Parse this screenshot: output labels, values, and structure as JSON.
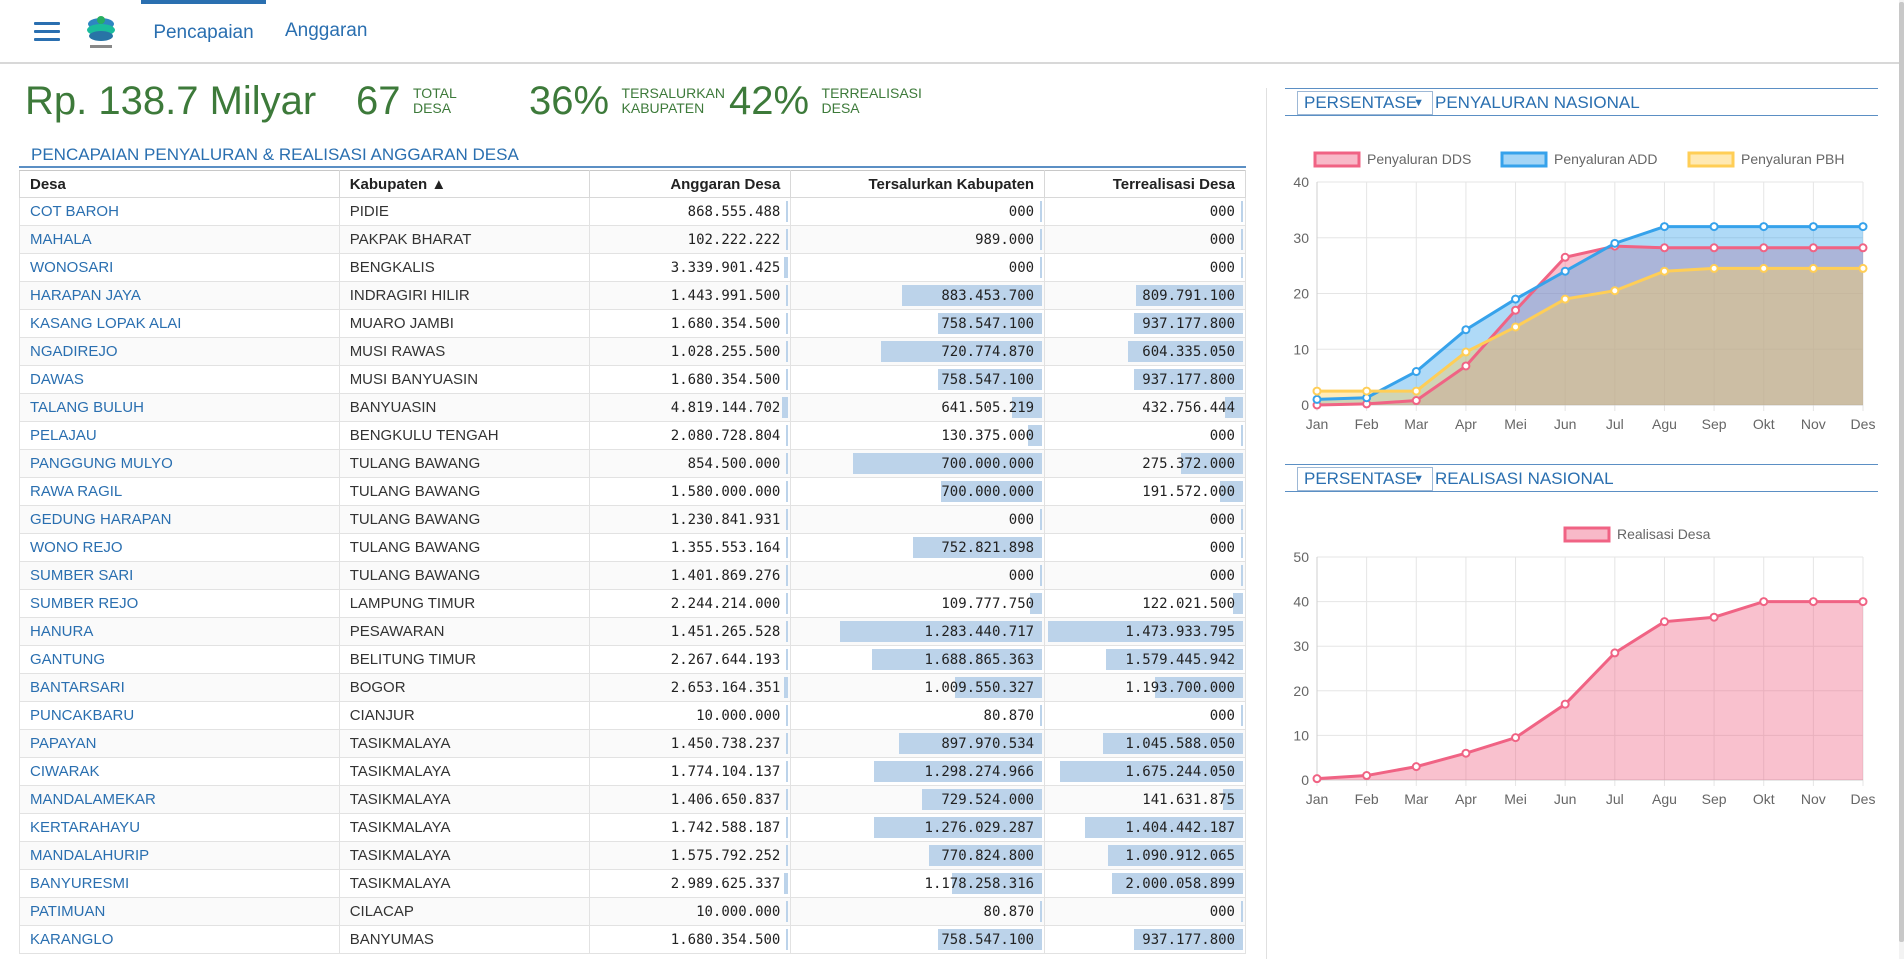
{
  "nav": {
    "menu_icon": "hamburger-menu-icon",
    "logo_icon": "kementerian-logo-icon",
    "tabs": [
      {
        "label": "Pencapaian",
        "active": true
      },
      {
        "label": "Anggaran",
        "active": false
      }
    ]
  },
  "summary": {
    "total_amount": "Rp. 138.7 Milyar",
    "total_desa_value": "67",
    "total_desa_label_1": "TOTAL",
    "total_desa_label_2": "DESA",
    "tersalurkan_value": "36%",
    "tersalurkan_label_1": "TERSALURKAN",
    "tersalurkan_label_2": "KABUPATEN",
    "terrealisasi_value": "42%",
    "terrealisasi_label_1": "TERREALISASI",
    "terrealisasi_label_2": "DESA"
  },
  "table": {
    "title": "PENCAPAIAN PENYALURAN & REALISASI ANGGARAN DESA",
    "columns": [
      "Desa",
      "Kabupaten ▲",
      "Anggaran Desa",
      "Tersalurkan Kabupaten",
      "Terrealisasi Desa"
    ],
    "rows": [
      {
        "desa": "COT BAROH",
        "kab": "PIDIE",
        "ang": "868.555.488",
        "ters": "000",
        "terr": "000",
        "ang_r": 0.01,
        "ters_r": 0.01,
        "terr_r": 0.01
      },
      {
        "desa": "MAHALA",
        "kab": "PAKPAK BHARAT",
        "ang": "102.222.222",
        "ters": "989.000",
        "terr": "000",
        "ang_r": 0.01,
        "ters_r": 0.01,
        "terr_r": 0.01
      },
      {
        "desa": "WONOSARI",
        "kab": "BENGKALIS",
        "ang": "3.339.901.425",
        "ters": "000",
        "terr": "000",
        "ang_r": 0.02,
        "ters_r": 0.01,
        "terr_r": 0.01
      },
      {
        "desa": "HARAPAN JAYA",
        "kab": "INDRAGIRI HILIR",
        "ang": "1.443.991.500",
        "ters": "883.453.700",
        "terr": "809.791.100",
        "ang_r": 0.01,
        "ters_r": 0.61,
        "terr_r": 0.55
      },
      {
        "desa": "KASANG LOPAK ALAI",
        "kab": "MUARO JAMBI",
        "ang": "1.680.354.500",
        "ters": "758.547.100",
        "terr": "937.177.800",
        "ang_r": 0.01,
        "ters_r": 0.45,
        "terr_r": 0.56
      },
      {
        "desa": "NGADIREJO",
        "kab": "MUSI RAWAS",
        "ang": "1.028.255.500",
        "ters": "720.774.870",
        "terr": "604.335.050",
        "ang_r": 0.01,
        "ters_r": 0.7,
        "terr_r": 0.59
      },
      {
        "desa": "DAWAS",
        "kab": "MUSI BANYUASIN",
        "ang": "1.680.354.500",
        "ters": "758.547.100",
        "terr": "937.177.800",
        "ang_r": 0.01,
        "ters_r": 0.45,
        "terr_r": 0.56
      },
      {
        "desa": "TALANG BULUH",
        "kab": "BANYUASIN",
        "ang": "4.819.144.702",
        "ters": "641.505.219",
        "terr": "432.756.444",
        "ang_r": 0.03,
        "ters_r": 0.13,
        "terr_r": 0.09
      },
      {
        "desa": "PELAJAU",
        "kab": "BENGKULU TENGAH",
        "ang": "2.080.728.804",
        "ters": "130.375.000",
        "terr": "000",
        "ang_r": 0.01,
        "ters_r": 0.06,
        "terr_r": 0.01
      },
      {
        "desa": "PANGGUNG MULYO",
        "kab": "TULANG BAWANG",
        "ang": "854.500.000",
        "ters": "700.000.000",
        "terr": "275.372.000",
        "ang_r": 0.01,
        "ters_r": 0.82,
        "terr_r": 0.32
      },
      {
        "desa": "RAWA RAGIL",
        "kab": "TULANG BAWANG",
        "ang": "1.580.000.000",
        "ters": "700.000.000",
        "terr": "191.572.000",
        "ang_r": 0.01,
        "ters_r": 0.44,
        "terr_r": 0.12
      },
      {
        "desa": "GEDUNG HARAPAN",
        "kab": "TULANG BAWANG",
        "ang": "1.230.841.931",
        "ters": "000",
        "terr": "000",
        "ang_r": 0.01,
        "ters_r": 0.01,
        "terr_r": 0.01
      },
      {
        "desa": "WONO REJO",
        "kab": "TULANG BAWANG",
        "ang": "1.355.553.164",
        "ters": "752.821.898",
        "terr": "000",
        "ang_r": 0.01,
        "ters_r": 0.56,
        "terr_r": 0.01
      },
      {
        "desa": "SUMBER SARI",
        "kab": "TULANG BAWANG",
        "ang": "1.401.869.276",
        "ters": "000",
        "terr": "000",
        "ang_r": 0.01,
        "ters_r": 0.01,
        "terr_r": 0.01
      },
      {
        "desa": "SUMBER REJO",
        "kab": "LAMPUNG TIMUR",
        "ang": "2.244.214.000",
        "ters": "109.777.750",
        "terr": "122.021.500",
        "ang_r": 0.01,
        "ters_r": 0.05,
        "terr_r": 0.05
      },
      {
        "desa": "HANURA",
        "kab": "PESAWARAN",
        "ang": "1.451.265.528",
        "ters": "1.283.440.717",
        "terr": "1.473.933.795",
        "ang_r": 0.01,
        "ters_r": 0.88,
        "terr_r": 1.0
      },
      {
        "desa": "GANTUNG",
        "kab": "BELITUNG TIMUR",
        "ang": "2.267.644.193",
        "ters": "1.688.865.363",
        "terr": "1.579.445.942",
        "ang_r": 0.01,
        "ters_r": 0.74,
        "terr_r": 0.7
      },
      {
        "desa": "BANTARSARI",
        "kab": "BOGOR",
        "ang": "2.653.164.351",
        "ters": "1.009.550.327",
        "terr": "1.193.700.000",
        "ang_r": 0.02,
        "ters_r": 0.38,
        "terr_r": 0.45
      },
      {
        "desa": "PUNCAKBARU",
        "kab": "CIANJUR",
        "ang": "10.000.000",
        "ters": "80.870",
        "terr": "000",
        "ang_r": 0.01,
        "ters_r": 0.01,
        "terr_r": 0.01
      },
      {
        "desa": "PAPAYAN",
        "kab": "TASIKMALAYA",
        "ang": "1.450.738.237",
        "ters": "897.970.534",
        "terr": "1.045.588.050",
        "ang_r": 0.01,
        "ters_r": 0.62,
        "terr_r": 0.72
      },
      {
        "desa": "CIWARAK",
        "kab": "TASIKMALAYA",
        "ang": "1.774.104.137",
        "ters": "1.298.274.966",
        "terr": "1.675.244.050",
        "ang_r": 0.01,
        "ters_r": 0.73,
        "terr_r": 0.94
      },
      {
        "desa": "MANDALAMEKAR",
        "kab": "TASIKMALAYA",
        "ang": "1.406.650.837",
        "ters": "729.524.000",
        "terr": "141.631.875",
        "ang_r": 0.01,
        "ters_r": 0.52,
        "terr_r": 0.1
      },
      {
        "desa": "KERTARAHAYU",
        "kab": "TASIKMALAYA",
        "ang": "1.742.588.187",
        "ters": "1.276.029.287",
        "terr": "1.404.442.187",
        "ang_r": 0.01,
        "ters_r": 0.73,
        "terr_r": 0.81
      },
      {
        "desa": "MANDALAHURIP",
        "kab": "TASIKMALAYA",
        "ang": "1.575.792.252",
        "ters": "770.824.800",
        "terr": "1.090.912.065",
        "ang_r": 0.01,
        "ters_r": 0.49,
        "terr_r": 0.69
      },
      {
        "desa": "BANYURESMI",
        "kab": "TASIKMALAYA",
        "ang": "2.989.625.337",
        "ters": "1.178.258.316",
        "terr": "2.000.058.899",
        "ang_r": 0.02,
        "ters_r": 0.39,
        "terr_r": 0.67
      },
      {
        "desa": "PATIMUAN",
        "kab": "CILACAP",
        "ang": "10.000.000",
        "ters": "80.870",
        "terr": "000",
        "ang_r": 0.01,
        "ters_r": 0.01,
        "terr_r": 0.01
      },
      {
        "desa": "KARANGLO",
        "kab": "BANYUMAS",
        "ang": "1.680.354.500",
        "ters": "758.547.100",
        "terr": "937.177.800",
        "ang_r": 0.01,
        "ters_r": 0.45,
        "terr_r": 0.56
      }
    ]
  },
  "panel1": {
    "select_label": "PERSENTASE",
    "title": "PENYALURAN NASIONAL"
  },
  "panel2": {
    "select_label": "PERSENTASE",
    "title": "REALISASI NASIONAL"
  },
  "chart_data": [
    {
      "type": "area",
      "categories": [
        "Jan",
        "Feb",
        "Mar",
        "Apr",
        "Mei",
        "Jun",
        "Jul",
        "Agu",
        "Sep",
        "Okt",
        "Nov",
        "Des"
      ],
      "series": [
        {
          "name": "Penyaluran DDS",
          "color": "#f06384",
          "values": [
            0,
            0.2,
            0.8,
            7,
            17,
            26.5,
            28.5,
            28.2,
            28.2,
            28.2,
            28.2,
            28.2
          ]
        },
        {
          "name": "Penyaluran ADD",
          "color": "#36a2eb",
          "values": [
            1,
            1.3,
            6,
            13.5,
            19,
            24,
            29,
            32,
            32,
            32,
            32,
            32
          ]
        },
        {
          "name": "Penyaluran PBH",
          "color": "#ffce56",
          "values": [
            2.5,
            2.5,
            2.5,
            9.5,
            14,
            19,
            20.5,
            24,
            24.5,
            24.5,
            24.5,
            24.5
          ]
        }
      ],
      "ylim": [
        0,
        40
      ],
      "yticks": [
        0,
        10,
        20,
        30,
        40
      ],
      "legend_position": "top",
      "grid": true
    },
    {
      "type": "area",
      "categories": [
        "Jan",
        "Feb",
        "Mar",
        "Apr",
        "Mei",
        "Jun",
        "Jul",
        "Agu",
        "Sep",
        "Okt",
        "Nov",
        "Des"
      ],
      "series": [
        {
          "name": "Realisasi Desa",
          "color": "#f06384",
          "values": [
            0.3,
            1,
            3,
            6,
            9.5,
            17,
            28.5,
            35.5,
            36.5,
            40,
            40,
            40
          ]
        }
      ],
      "ylim": [
        0,
        50
      ],
      "yticks": [
        0,
        10,
        20,
        30,
        40,
        50
      ],
      "legend_position": "top",
      "grid": true
    }
  ]
}
